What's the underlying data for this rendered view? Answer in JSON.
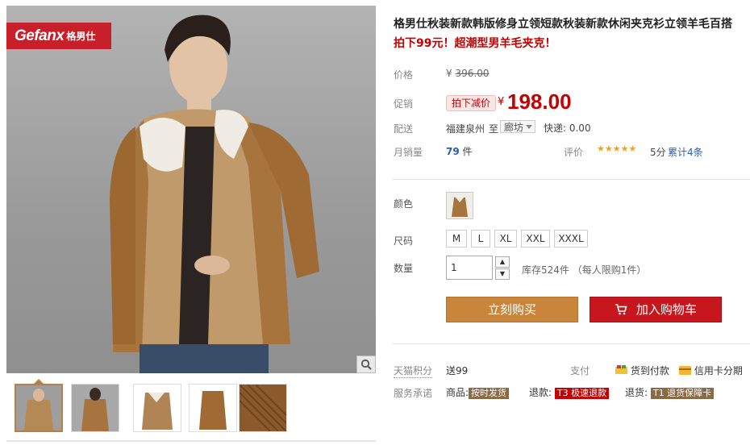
{
  "colors": {
    "accent": "#c40000",
    "buy": "#c8853b",
    "cart": "#c8161e",
    "brand": "#c8202a"
  },
  "brand": {
    "logo_text": "Gefanx",
    "logo_cn": "格男仕"
  },
  "product": {
    "title": "格男仕秋装新款韩版修身立领短款秋装新款休闲夹克衫立领羊毛百搭",
    "subtitle": "拍下99元！超潮型男羊毛夹克！"
  },
  "price": {
    "label": "价格",
    "currency": "¥",
    "original": "396.00",
    "promo_label": "促销",
    "promo_badge": "拍下减价",
    "promo_value": "198.00"
  },
  "shipping": {
    "label": "配送",
    "from": "福建泉州",
    "to_word": "至",
    "destination": "廊坊",
    "express": "快递: 0.00"
  },
  "sales": {
    "label": "月销量",
    "count": "79",
    "unit": "件",
    "rating_label": "评价",
    "stars": "★★★★★",
    "score": "5分",
    "reviews": "累计4条"
  },
  "options": {
    "color_label": "颜色",
    "size_label": "尺码",
    "sizes": [
      "M",
      "L",
      "XL",
      "XXL",
      "XXXL"
    ],
    "qty_label": "数量",
    "qty_value": "1",
    "stock": "库存524件 （每人限购1件）"
  },
  "actions": {
    "buy_now": "立刻购买",
    "add_cart": "加入购物车"
  },
  "extra": {
    "points_label": "天猫积分",
    "points_value": "送99",
    "pay_label": "支付",
    "cod": "货到付款",
    "credit": "信用卡分期",
    "promise_label": "服务承诺",
    "goods_label": "商品:",
    "goods_tag": "按时发货",
    "refund_label": "退款:",
    "refund_tag": "T3 极速退款",
    "return_label": "退货:",
    "return_tag": "T1 退货保障卡"
  }
}
